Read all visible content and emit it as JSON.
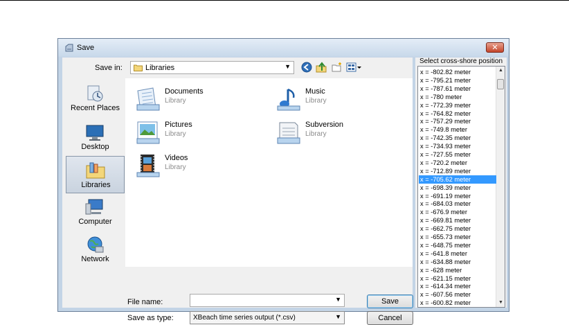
{
  "window": {
    "title": "Save",
    "close_glyph": "✕"
  },
  "toolbar": {
    "save_in_label": "Save in:",
    "save_in_value": "Libraries",
    "icons": [
      "back-icon",
      "up-folder-icon",
      "new-folder-icon",
      "views-menu-icon"
    ]
  },
  "places": [
    {
      "label": "Recent Places",
      "icon": "recent-places-icon"
    },
    {
      "label": "Desktop",
      "icon": "desktop-icon"
    },
    {
      "label": "Libraries",
      "icon": "libraries-icon",
      "selected": true
    },
    {
      "label": "Computer",
      "icon": "computer-icon"
    },
    {
      "label": "Network",
      "icon": "network-icon"
    }
  ],
  "libraries": [
    {
      "name": "Documents",
      "sub": "Library",
      "icon": "documents-library-icon"
    },
    {
      "name": "Music",
      "sub": "Library",
      "icon": "music-library-icon"
    },
    {
      "name": "Pictures",
      "sub": "Library",
      "icon": "pictures-library-icon"
    },
    {
      "name": "Subversion",
      "sub": "Library",
      "icon": "subversion-library-icon"
    },
    {
      "name": "Videos",
      "sub": "Library",
      "icon": "videos-library-icon"
    }
  ],
  "form": {
    "file_name_label": "File name:",
    "file_name_value": "",
    "save_as_type_label": "Save as type:",
    "save_as_type_value": "XBeach time series output (*.csv)",
    "save_button": "Save",
    "cancel_button": "Cancel"
  },
  "side_panel": {
    "title": "Select cross-shore position",
    "selected_index": 14,
    "items": [
      "x = -802.82 meter",
      "x = -795.21 meter",
      "x = -787.61 meter",
      "x = -780 meter",
      "x = -772.39 meter",
      "x = -764.82 meter",
      "x = -757.29 meter",
      "x = -749.8 meter",
      "x = -742.35 meter",
      "x = -734.93 meter",
      "x = -727.55 meter",
      "x = -720.2 meter",
      "x = -712.89 meter",
      "x = -705.62 meter",
      "x = -698.39 meter",
      "x = -691.19 meter",
      "x = -684.03 meter",
      "x = -676.9 meter",
      "x = -669.81 meter",
      "x = -662.75 meter",
      "x = -655.73 meter",
      "x = -648.75 meter",
      "x = -641.8 meter",
      "x = -634.88 meter",
      "x = -628 meter",
      "x = -621.15 meter",
      "x = -614.34 meter",
      "x = -607.56 meter",
      "x = -600.82 meter"
    ]
  },
  "colors": {
    "selection": "#3399ff",
    "frame": "#c3d4e6",
    "close": "#c4452a"
  }
}
